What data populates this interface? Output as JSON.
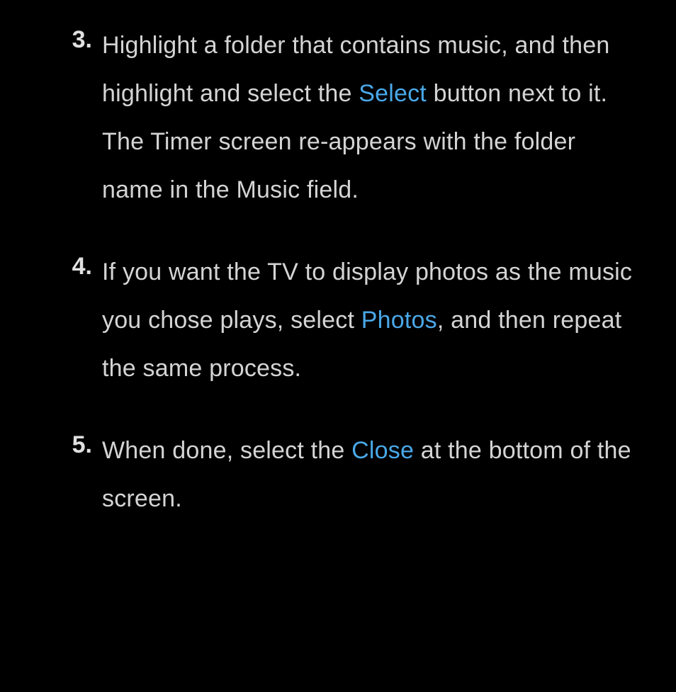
{
  "steps": [
    {
      "marker": "3.",
      "segments": [
        {
          "t": "Highlight a folder that contains music, and then highlight and select the "
        },
        {
          "t": "Select",
          "kw": true
        },
        {
          "t": " button next to it. The Timer screen re-appears with the folder name in the Music field."
        }
      ]
    },
    {
      "marker": "4.",
      "segments": [
        {
          "t": "If you want the TV to display photos as the music you chose plays, select "
        },
        {
          "t": "Photos",
          "kw": true
        },
        {
          "t": ", and then repeat the same process."
        }
      ]
    },
    {
      "marker": "5.",
      "segments": [
        {
          "t": "When done, select the "
        },
        {
          "t": "Close",
          "kw": true
        },
        {
          "t": " at the bottom of the screen."
        }
      ]
    }
  ]
}
